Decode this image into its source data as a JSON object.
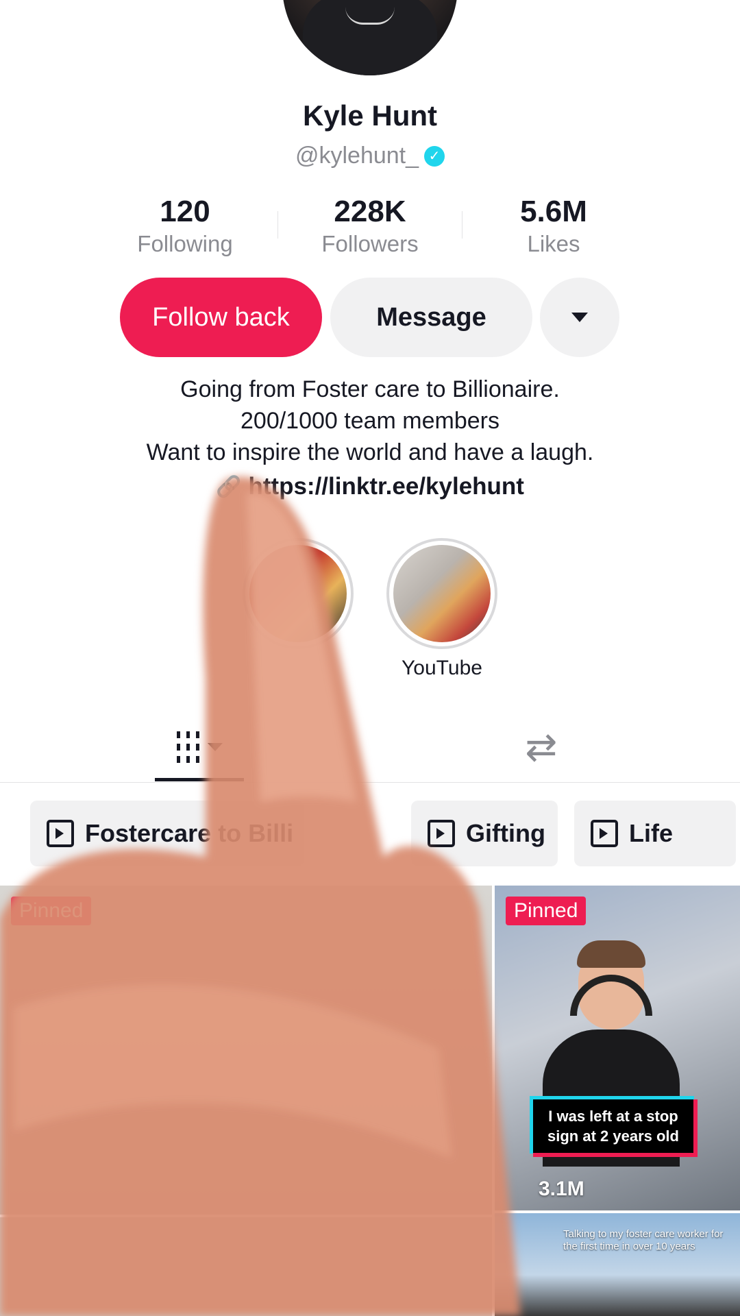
{
  "profile": {
    "name": "Kyle Hunt",
    "handle": "@kylehunt_",
    "verified_icon": "verified-icon"
  },
  "stats": [
    {
      "value": "120",
      "label": "Following"
    },
    {
      "value": "228K",
      "label": "Followers"
    },
    {
      "value": "5.6M",
      "label": "Likes"
    }
  ],
  "actions": {
    "follow_label": "Follow back",
    "message_label": "Message",
    "more_icon": "chevron-down-icon"
  },
  "bio": {
    "line1": "Going from Foster care to Billionaire.",
    "line2": "200/1000 team members",
    "line3": "Want to inspire the world and have a laugh.",
    "link": "https://linktr.ee/kylehunt"
  },
  "highlights": [
    {
      "label": ""
    },
    {
      "label": "YouTube"
    }
  ],
  "tabs": {
    "grid_icon": "videos-grid-icon",
    "repost_icon": "repost-icon"
  },
  "playlists": [
    {
      "label": "Fostercare to Billi"
    },
    {
      "label": "Gifting"
    },
    {
      "label": "Life"
    }
  ],
  "videos": [
    {
      "badge": "Pinned",
      "caption": "",
      "views": ""
    },
    {
      "badge": "Pinned",
      "caption": "I was left at a stop sign at 2 years old",
      "views": "3.1M"
    },
    {
      "badge": "",
      "caption": "Talking to my foster care worker for the first time in over 10 years",
      "views": ""
    }
  ],
  "colors": {
    "accent": "#ee1d52",
    "verified": "#20d5ec",
    "muted_text": "#8a8b91",
    "button_bg": "#f1f1f2"
  }
}
